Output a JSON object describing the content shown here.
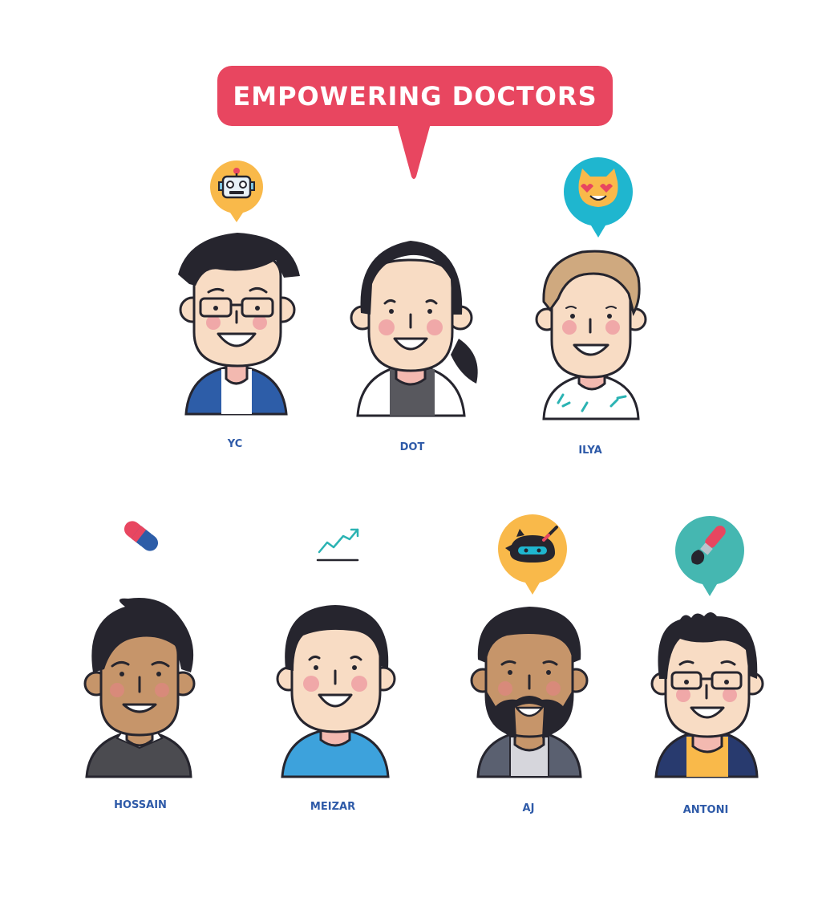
{
  "banner": {
    "title": "EMPOWERING DOCTORS"
  },
  "people": [
    {
      "name": "YC"
    },
    {
      "name": "DOT"
    },
    {
      "name": "ILYA"
    },
    {
      "name": "HOSSAIN"
    },
    {
      "name": "MEIZAR"
    },
    {
      "name": "AJ"
    },
    {
      "name": "ANTONI"
    }
  ],
  "colors": {
    "banner": "#e84660",
    "name_text": "#2e5aa8",
    "outline": "#26252e",
    "skin_light": "#f8dcc4",
    "skin_tan": "#c6956a",
    "blush": "#f0a8a8",
    "bubble_yellow": "#f9b94a",
    "bubble_cyan": "#1fb6cf",
    "bubble_teal": "#45b7b1"
  },
  "icons": [
    "robot-icon",
    "heart-eyes-cat-icon",
    "pill-icon",
    "trending-up-icon",
    "ninja-icon",
    "paintbrush-icon"
  ]
}
